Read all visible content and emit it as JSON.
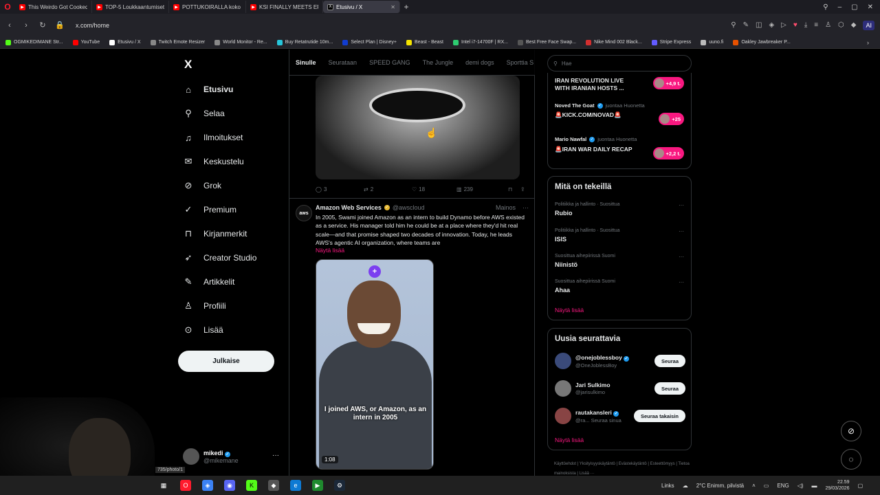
{
  "browser": {
    "tabs": [
      {
        "title": "This Weirdo Got Cooked",
        "color": "#ff0000",
        "active": false
      },
      {
        "title": "TOP-5 Loukkaantumiset",
        "color": "#ff0000",
        "active": false
      },
      {
        "title": "POTTUKOIRALLA koko Arr",
        "color": "#ff0000",
        "active": false
      },
      {
        "title": "KSI FINALLY MEETS EPIC S",
        "color": "#ff0000",
        "active": false
      },
      {
        "title": "Etusivu / X",
        "color": "#000000",
        "active": true
      }
    ],
    "url": "x.com/home",
    "ai_label": "AI",
    "bookmarks": [
      {
        "label": "OGMIKEDIMANE Str...",
        "color": "#53fc18"
      },
      {
        "label": "YouTube",
        "color": "#ff0000"
      },
      {
        "label": "Etusivu / X",
        "color": "#ffffff"
      },
      {
        "label": "Twitch Emote Resizer",
        "color": "#888888"
      },
      {
        "label": "World Monitor - Re...",
        "color": "#888888"
      },
      {
        "label": "Buy Retatrutide 10m...",
        "color": "#26c6da"
      },
      {
        "label": "Select Plan | Disney+",
        "color": "#113ccf"
      },
      {
        "label": "Beast - Beast",
        "color": "#f5e400"
      },
      {
        "label": "Intel i7-14700F | RX...",
        "color": "#2ecc71"
      },
      {
        "label": "Best Free Face Swap...",
        "color": "#555555"
      },
      {
        "label": "Nike Mind 002 Black...",
        "color": "#d32f2f"
      },
      {
        "label": "Stripe Express",
        "color": "#635bff"
      },
      {
        "label": "uuno.fi",
        "color": "#bbbbbb"
      },
      {
        "label": "Oakley Jawbreaker P...",
        "color": "#e65100"
      }
    ]
  },
  "sidebar": {
    "logo": "X",
    "items": [
      {
        "label": "Etusivu",
        "icon": "⌂"
      },
      {
        "label": "Selaa",
        "icon": "⚲"
      },
      {
        "label": "Ilmoitukset",
        "icon": "♫"
      },
      {
        "label": "Keskustelu",
        "icon": "✉"
      },
      {
        "label": "Grok",
        "icon": "⊘"
      },
      {
        "label": "Premium",
        "icon": "✓"
      },
      {
        "label": "Kirjanmerkit",
        "icon": "⊓"
      },
      {
        "label": "Creator Studio",
        "icon": "➶"
      },
      {
        "label": "Artikkelit",
        "icon": "✎"
      },
      {
        "label": "Profiili",
        "icon": "♙"
      },
      {
        "label": "Lisää",
        "icon": "⊙"
      }
    ],
    "post_button": "Julkaise",
    "profile": {
      "name": "mikedi",
      "handle": "@mikemane"
    }
  },
  "feed": {
    "tabs": [
      "Sinulle",
      "Seurataan",
      "SPEED GANG",
      "The Jungle",
      "demi dogs",
      "Sporttia S"
    ],
    "post1_actions": {
      "replies": "3",
      "reposts": "2",
      "likes": "18",
      "views": "239"
    },
    "post2": {
      "author": "Amazon Web Services",
      "handle": "@awscloud",
      "ad_label": "Mainos",
      "avatar_text": "aws",
      "text": "In 2005, Swami joined Amazon as an intern to build Dynamo before AWS existed as a service. His manager told him he could be at a place where they'd hit real scale—and that promise shaped two decades of innovation. Today, he leads AWS's agentic AI organization, where teams are",
      "show_more": "Näytä lisää",
      "video_caption": "I joined AWS, or Amazon, as an intern in 2005",
      "video_time": "1:08"
    }
  },
  "right": {
    "search_placeholder": "Hae",
    "live": [
      {
        "title": "IRAN REVOLUTION LIVE WITH IRANIAN HOSTS ...",
        "count": "+4,9 t."
      },
      {
        "host": "Noved The Goat",
        "label": "juontaa Huonetta",
        "title": "🚨KICK.COM/NOVAD🚨",
        "count": "+25"
      },
      {
        "host": "Mario Nawfal",
        "label": "juontaa Huonetta",
        "title": "🚨IRAN WAR DAILY RECAP",
        "count": "+2,2 t."
      }
    ],
    "trends_title": "Mitä on tekeillä",
    "trends": [
      {
        "meta": "Politiikka ja hallinto · Suosittua",
        "name": "Rubio"
      },
      {
        "meta": "Politiikka ja hallinto · Suosittua",
        "name": "ISIS"
      },
      {
        "meta": "Suosittua aihepiirissä Suomi",
        "name": "Niinistö"
      },
      {
        "meta": "Suosittua aihepiirissä Suomi",
        "name": "Ahaa"
      }
    ],
    "trends_more": "Näytä lisää",
    "wtf_title": "Uusia seurattavia",
    "wtf": [
      {
        "name": "@onejoblessboy",
        "handle": "@OneJoblessBoy",
        "button": "Seuraa"
      },
      {
        "name": "Jari Sulkimo",
        "handle": "@jarisulkimo",
        "button": "Seuraa"
      },
      {
        "name": "rautakansleri",
        "handle": "@ra... Seuraa sinua",
        "button": "Seuraa takaisin"
      }
    ],
    "wtf_more": "Näytä lisää",
    "footer": "Käyttöehdot | Yksityisyyskäytäntö | Evästekäytäntö | Esteettömyys | Tietoa mainoksista | Lisää ···"
  },
  "overlay": {
    "url_hint": "735/photo/1"
  },
  "taskbar": {
    "links": "Links",
    "weather": "2°C  Enimm. pilvistä",
    "lang": "ENG",
    "time": "22.59",
    "date": "29/03/2026"
  }
}
